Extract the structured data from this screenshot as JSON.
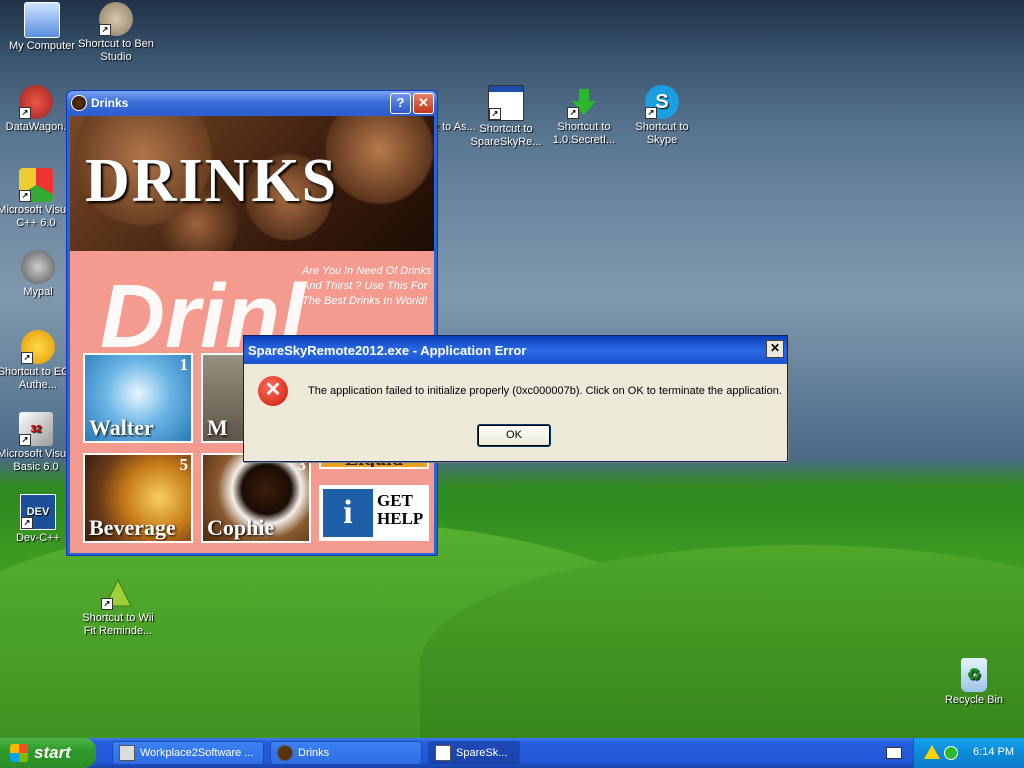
{
  "desktop_icons": [
    {
      "label": "My Computer"
    },
    {
      "label": "Shortcut to Ben Studio"
    },
    {
      "label": "DataWagon."
    },
    {
      "label": "Microsoft Visual C++ 6.0"
    },
    {
      "label": "Mypal"
    },
    {
      "label": "Shortcut to EOQ Authe..."
    },
    {
      "label": "Microsoft Visual Basic 6.0"
    },
    {
      "label": "Dev-C++"
    },
    {
      "label": "Shortcut to Wii Fit Reminde..."
    },
    {
      "label": "t to As..."
    },
    {
      "label": "Shortcut to SpareSkyRe..."
    },
    {
      "label": "Shortcut to 1.0.SecretI..."
    },
    {
      "label": "Shortcut to Skype"
    },
    {
      "label": "Recycle Bin"
    }
  ],
  "drinks_window": {
    "title": "Drinks",
    "help_button": "?",
    "close_button": "✕",
    "banner_title": "DRINKS",
    "big_text": "Drinl",
    "tagline": "Are You In Need Of Drinks And Thirst ? Use This For The Best Drinks In World!",
    "tiles": [
      {
        "label": "Walter",
        "number": "1"
      },
      {
        "label": "M",
        "number": ""
      },
      {
        "label": "Liquid",
        "number": ""
      },
      {
        "label": "Beverage",
        "number": "5"
      },
      {
        "label": "Cophie",
        "number": "3"
      },
      {
        "label": "GET HELP",
        "number": "",
        "icon_text": "i"
      }
    ]
  },
  "error_dialog": {
    "title": "SpareSkyRemote2012.exe - Application Error",
    "message": "The application failed to initialize properly (0xc000007b). Click on OK to terminate the application.",
    "ok_label": "OK",
    "close_label": "✕",
    "icon": "error-icon"
  },
  "taskbar": {
    "start_label": "start",
    "tasks": [
      {
        "label": "Workplace2Software ..."
      },
      {
        "label": "Drinks"
      },
      {
        "label": "SpareSk..."
      }
    ],
    "clock": "6:14 PM"
  }
}
